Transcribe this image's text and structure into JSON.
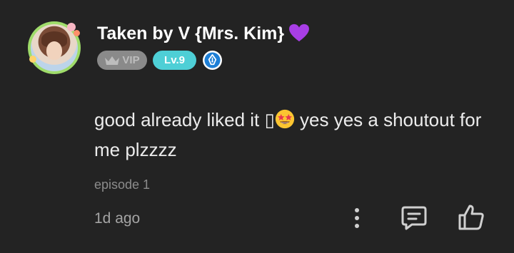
{
  "user": {
    "name": "Taken by V {Mrs. Kim}",
    "name_emoji": "purple-heart-icon",
    "vip_label": "VIP",
    "level_label": "Lv.9",
    "pen_badge_icon": "fountain-pen-icon"
  },
  "comment": {
    "text_before": "good already liked it ▯",
    "emoji": "star-struck-icon",
    "text_after": " yes yes a shoutout for me plzzzz"
  },
  "episode": "episode 1",
  "time": "1d ago",
  "actions": {
    "more_icon": "more-vertical-icon",
    "reply_icon": "reply-comment-icon",
    "like_icon": "thumbs-up-icon"
  },
  "colors": {
    "background": "#232323",
    "vip_badge": "#8a8a8a",
    "level_badge": "#4ecfd6",
    "pen_badge": "#1e7fd6",
    "heart": "#a83ee6"
  }
}
